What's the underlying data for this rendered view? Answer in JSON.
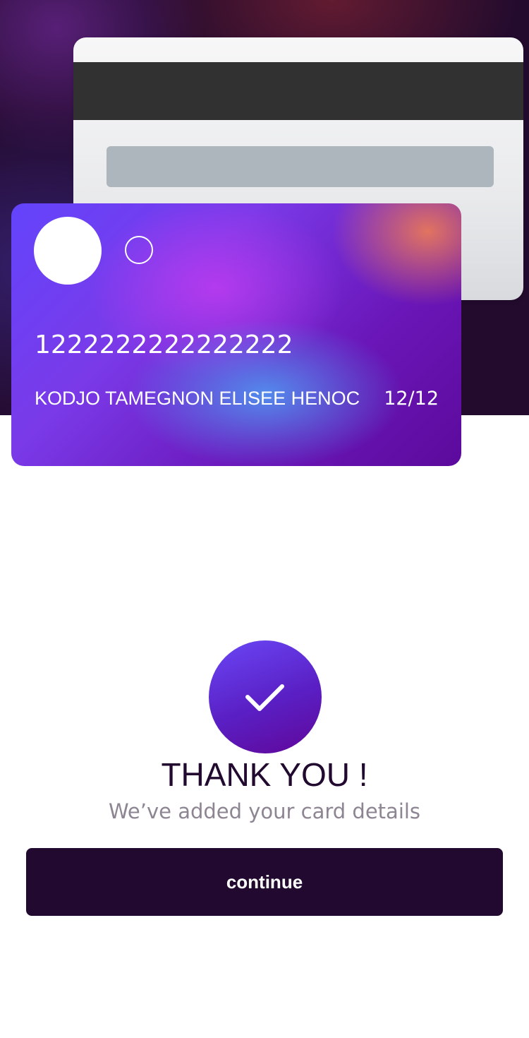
{
  "card": {
    "number": "1222222222222222",
    "holder_name": "KODJO TAMEGNON ELISEE HENOC",
    "expiry": "12/12"
  },
  "confirmation": {
    "icon": "check-icon",
    "title": "THANK YOU !",
    "subtitle": "We’ve added your card details"
  },
  "actions": {
    "continue_label": "continue"
  },
  "colors": {
    "dark": "#21092f",
    "accent": "#6a47f6",
    "muted_text": "#8e8593"
  }
}
